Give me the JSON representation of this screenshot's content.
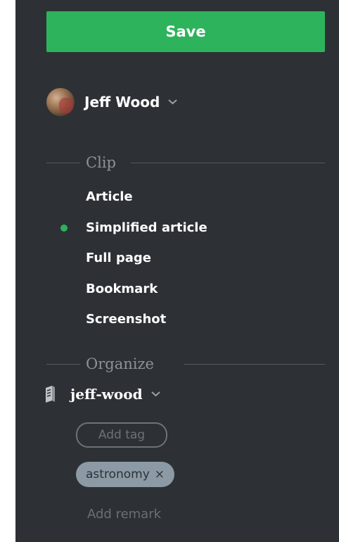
{
  "save_button": {
    "label": "Save"
  },
  "account": {
    "name": "Jeff Wood"
  },
  "clip": {
    "title": "Clip",
    "options": [
      {
        "label": "Article",
        "selected": false
      },
      {
        "label": "Simplified article",
        "selected": true
      },
      {
        "label": "Full page",
        "selected": false
      },
      {
        "label": "Bookmark",
        "selected": false
      },
      {
        "label": "Screenshot",
        "selected": false
      }
    ]
  },
  "organize": {
    "title": "Organize",
    "notebook": "jeff-wood",
    "add_tag_placeholder": "Add tag",
    "tags": [
      {
        "label": "astronomy",
        "remove_icon": "×"
      }
    ],
    "add_remark": "Add remark"
  },
  "colors": {
    "panel_bg": "#2d3135",
    "accent_green": "#2db35b",
    "tag_bg": "#8b9aa5"
  }
}
